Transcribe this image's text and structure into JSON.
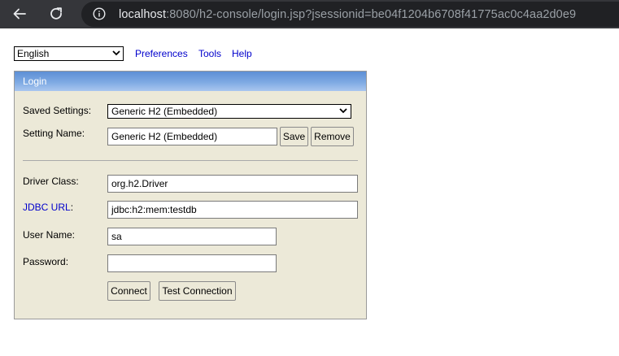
{
  "browser": {
    "url_host": "localhost",
    "url_rest": ":8080/h2-console/login.jsp?jsessionid=be04f1204b6708f41775ac0c4aa2d0e9",
    "icons": [
      "back-arrow-icon",
      "reload-icon",
      "info-icon"
    ]
  },
  "toolbar": {
    "language": "English",
    "links": [
      "Preferences",
      "Tools",
      "Help"
    ]
  },
  "login": {
    "title": "Login",
    "saved_settings_label": "Saved Settings:",
    "saved_settings_value": "Generic H2 (Embedded)",
    "setting_name_label": "Setting Name:",
    "setting_name_value": "Generic H2 (Embedded)",
    "save_label": "Save",
    "remove_label": "Remove",
    "driver_class_label": "Driver Class:",
    "driver_class_value": "org.h2.Driver",
    "jdbc_url_link": "JDBC URL",
    "jdbc_url_colon": ":",
    "jdbc_url_value": "jdbc:h2:mem:testdb",
    "user_name_label": "User Name:",
    "user_name_value": "sa",
    "password_label": "Password:",
    "password_value": "",
    "connect_label": "Connect",
    "test_connection_label": "Test Connection"
  },
  "colors": {
    "chrome_bg": "#35363a",
    "omnibox_bg": "#202124",
    "panel_bg": "#ece9d8",
    "header_blue": "#6a9be0",
    "link_blue": "#0000cc"
  }
}
